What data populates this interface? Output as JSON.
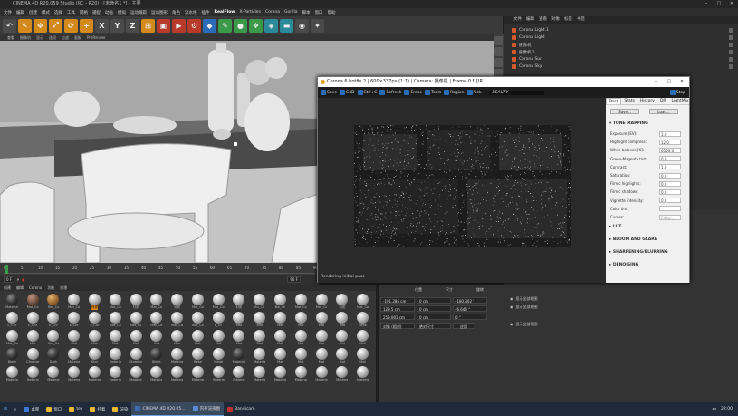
{
  "window": {
    "title": "CINEMA 4D R20.059 Studio (RC - R20) - [未命名1 *] - 主要"
  },
  "menubar": {
    "items": [
      "文件",
      "编辑",
      "创建",
      "模式",
      "选择",
      "工具",
      "网格",
      "捕捉",
      "动画",
      "模拟",
      "运动跟踪",
      "运动图形",
      "角色",
      "流水线",
      "插件",
      "RealFlow",
      "X-Particles",
      "Corona",
      "Gorilla",
      "脚本",
      "窗口",
      "帮助"
    ],
    "highlight": "RealFlow"
  },
  "toolbar": {
    "icons": [
      "undo-icon",
      "pointer-icon",
      "move-icon",
      "scale-icon",
      "rotate-icon",
      "add-icon",
      "x-axis-icon",
      "y-axis-icon",
      "z-axis-icon",
      "coord-icon",
      "render-region-icon",
      "render-view-icon",
      "render-settings-icon",
      "cube-icon",
      "pen-icon",
      "subdivision-icon",
      "cloner-icon",
      "deformer-icon",
      "floor-icon",
      "camera-icon",
      "light-icon"
    ],
    "axis_labels": [
      "X",
      "Y",
      "Z"
    ]
  },
  "viewport": {
    "menu": [
      "查看",
      "摄像机",
      "显示",
      "选项",
      "过滤",
      "面板",
      "ProRender"
    ]
  },
  "timeline": {
    "ticks": [
      "0",
      "5",
      "10",
      "15",
      "20",
      "25",
      "30",
      "35",
      "40",
      "45",
      "50",
      "55",
      "60",
      "65",
      "70",
      "75",
      "80",
      "85",
      "90"
    ],
    "start": "0 F",
    "end": "90 F"
  },
  "material_panel": {
    "tabs": [
      "创建",
      "编辑",
      "Corona",
      "功能",
      "纹理"
    ],
    "rows": [
      [
        "Material",
        "Mat_Co",
        "Mat_Co",
        "Mat_Co",
        "材质",
        "Mat_Co",
        "材质",
        "Mat_Co",
        "材质",
        "Mat_Co",
        "Mat_Co",
        "材质",
        "Bu_Ch",
        "Bw_Ch",
        "Mat_Co",
        "Mat_Co",
        "材质",
        "Mat_Co"
      ],
      [
        "E_Chr",
        "E_Chr",
        "E_Chr",
        "E_Chr",
        "E_Chr",
        "Mat_Co",
        "Mat_Co",
        "Mat_Co",
        "Mat_Co",
        "Mat_Co",
        "E_Ch",
        "Mat",
        "Mat",
        "Mat",
        "Mat",
        "Mat",
        "Mat",
        "Metal"
      ],
      [
        "Mat_Co",
        "Mat",
        "Mat_Co",
        "Mat",
        "Mat",
        "Mat",
        "Mat",
        "Mat",
        "Mat",
        "Mat",
        "Mat",
        "Mat",
        "Mat",
        "Mat",
        "Mat",
        "Mat",
        "Mat",
        "Mat"
      ],
      [
        "Black",
        "Chrome",
        "Dark",
        "Materia",
        "Stor",
        "Materia",
        "Materia",
        "Black",
        "Materia",
        "Metal",
        "Metal",
        "Material",
        "Materia",
        "Mat",
        "Mat",
        "Mat",
        "Mat",
        "Mat"
      ],
      [
        "Materia",
        "Materia",
        "Materia",
        "Materia",
        "Materia",
        "Materia",
        "Materia",
        "Materia",
        "Materia",
        "Materia",
        "Materia",
        "Materia",
        "Materia",
        "Materia",
        "Materia",
        "Materia",
        "Materia",
        "Materia"
      ]
    ],
    "selected": "材质"
  },
  "coord_panel": {
    "headers": [
      "位置",
      "尺寸",
      "旋转"
    ],
    "rows": [
      {
        "pos": "-101.286 cm",
        "size": "0 cm",
        "rot": "-180.302 °"
      },
      {
        "pos": "129.5 cm",
        "size": "0 cm",
        "rot": "-6.646 °"
      },
      {
        "pos": "253.001 cm",
        "size": "0 cm",
        "rot": "0 °"
      }
    ],
    "mode": "对象 (相对)",
    "size_mode": "绝对尺寸",
    "apply": "应用"
  },
  "object_panel": {
    "tabs": [
      "文件",
      "编辑",
      "查看",
      "对象",
      "标签",
      "书签"
    ],
    "items": [
      "Corona Light.1",
      "Corona Light",
      "摄像机",
      "摄像机.1",
      "Corona Sun",
      "Corona Sky"
    ]
  },
  "attr_panel": {
    "rows": [
      "显示全部视图",
      "显示全部视图",
      "显示全部视图"
    ]
  },
  "corona": {
    "title": "Corona 6 hotfix 2 | 600×337px (1:1) | Camera: 摄像机 | Frame 0 F [IR]",
    "toolbar": [
      "Save",
      "C4D",
      "Ctrl+C",
      "Refresh",
      "Erase",
      "Tools",
      "Region",
      "Pick"
    ],
    "pass": "BEAUTY",
    "stop": "Stop",
    "status": "Rendering initial pass",
    "side_tabs": [
      "Post",
      "Stats",
      "History",
      "DR",
      "LightMix"
    ],
    "active_tab": "Post",
    "save_btn": "Save...",
    "load_btn": "Load...",
    "tone_mapping": "TONE MAPPING",
    "settings": [
      {
        "label": "Exposure (EV):",
        "value": "1.0"
      },
      {
        "label": "Highlight compress:",
        "value": "12.0"
      },
      {
        "label": "White balance [K]:",
        "value": "6500.0"
      },
      {
        "label": "Green-Magenta tint:",
        "value": "0.0"
      },
      {
        "label": "Contrast:",
        "value": "1.0"
      },
      {
        "label": "Saturation:",
        "value": "0.0"
      },
      {
        "label": "Filmic highlights:",
        "value": "0.0"
      },
      {
        "label": "Filmic shadows:",
        "value": "0.0"
      },
      {
        "label": "Vignette intensity:",
        "value": "0.0"
      },
      {
        "label": "Color tint:",
        "value": ""
      },
      {
        "label": "Curves:",
        "value": "Editor..."
      }
    ],
    "sections": [
      "LUT",
      "BLOOM AND GLARE",
      "SHARPENING/BLURRING",
      "DENOISING"
    ]
  },
  "taskbar": {
    "items": [
      "桌面",
      "窗口",
      "tex",
      "打着",
      "渲染",
      "CINEMA 4D R20.05...",
      "内存渲染图",
      "Bandicam"
    ],
    "clock": "22:00",
    "ime": "中"
  },
  "colors": {
    "accent": "#e08a10",
    "corona_blue": "#2a6cb8",
    "viewport": "#b9b9b9"
  }
}
